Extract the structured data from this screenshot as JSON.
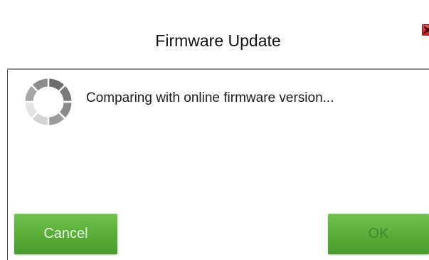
{
  "dialog": {
    "title": "Firmware Update",
    "close_icon": "close-icon",
    "spinner_icon": "loading-spinner-icon",
    "message": "Comparing with online firmware version...",
    "buttons": {
      "cancel_label": "Cancel",
      "ok_label": "OK",
      "ok_enabled": false
    },
    "colors": {
      "button_green": "#5bb03a",
      "close_red": "#d42a2a",
      "divider": "#8f8f8f"
    }
  }
}
